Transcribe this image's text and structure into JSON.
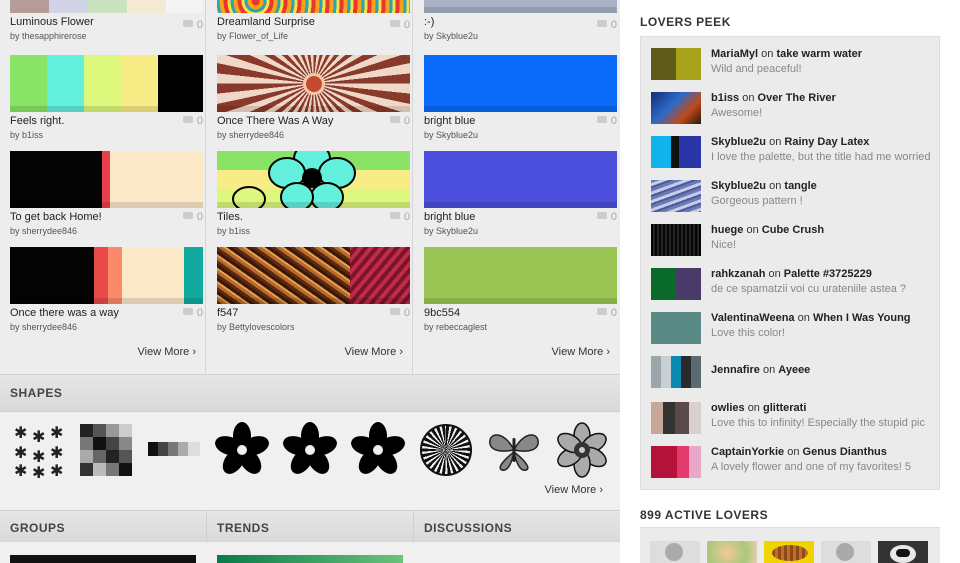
{
  "colors": {
    "accent_title": "#333333",
    "count": "#aaaaaa"
  },
  "grid": {
    "col1": [
      {
        "title": "Luminous Flower",
        "by": "by thesapphirerose",
        "count": "0"
      },
      {
        "title": "Feels right.",
        "by": "by b1iss",
        "count": "0"
      },
      {
        "title": "To get back Home!",
        "by": "by sherrydee846",
        "count": "0"
      },
      {
        "title": "Once there was a way",
        "by": "by sherrydee846",
        "count": "0"
      }
    ],
    "col2": [
      {
        "title": "Dreamland Surprise",
        "by": "by Flower_of_Life",
        "count": "0"
      },
      {
        "title": "Once There Was A Way",
        "by": "by sherrydee846",
        "count": "0"
      },
      {
        "title": "Tiles.",
        "by": "by b1iss",
        "count": "0"
      },
      {
        "title": "f547",
        "by": "by Bettylovescolors",
        "count": "0"
      }
    ],
    "col3": [
      {
        "title": ":-)",
        "by": "by Skyblue2u",
        "count": "0"
      },
      {
        "title": "bright blue",
        "by": "by Skyblue2u",
        "count": "0"
      },
      {
        "title": "bright blue",
        "by": "by Skyblue2u",
        "count": "0"
      },
      {
        "title": "9bc554",
        "by": "by rebeccaglest",
        "count": "0"
      }
    ],
    "view_more": "View More ›"
  },
  "shapes": {
    "title": "SHAPES",
    "view_more": "View More ›"
  },
  "bottom": {
    "groups": "GROUPS",
    "trends": "TRENDS",
    "discussions": "DISCUSSIONS"
  },
  "peek": {
    "title": "LOVERS PEEK",
    "items": [
      {
        "user": "MariaMyl",
        "on": "on",
        "target": "take warm water",
        "comment": "Wild and peaceful!"
      },
      {
        "user": "b1iss",
        "on": "on",
        "target": "Over The River",
        "comment": "Awesome!"
      },
      {
        "user": "Skyblue2u",
        "on": "on",
        "target": "Rainy Day Latex",
        "comment": "I love the palette, but the title had me worried"
      },
      {
        "user": "Skyblue2u",
        "on": "on",
        "target": "tangle",
        "comment": "Gorgeous pattern !"
      },
      {
        "user": "huege",
        "on": "on",
        "target": "Cube Crush",
        "comment": "Nice!"
      },
      {
        "user": "rahkzanah",
        "on": "on",
        "target": "Palette #3725229",
        "comment": "de ce spamatzii voi cu urateniile astea ?"
      },
      {
        "user": "ValentinaWeena",
        "on": "on",
        "target": "When I Was Young",
        "comment": "Love this color!"
      },
      {
        "user": "Jennafire",
        "on": "on",
        "target": "Ayeee",
        "comment": ""
      },
      {
        "user": "owlies",
        "on": "on",
        "target": "glitterati",
        "comment": "Love this to infinity! Especially the stupid pic"
      },
      {
        "user": "CaptainYorkie",
        "on": "on",
        "target": "Genus Dianthus",
        "comment": "A lovely flower and one of my favorites! 5"
      }
    ]
  },
  "active": {
    "title": "899 ACTIVE LOVERS"
  }
}
